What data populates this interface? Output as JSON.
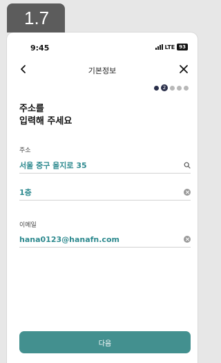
{
  "badge": {
    "label": "1.7"
  },
  "status_bar": {
    "time": "9:45",
    "network": "LTE",
    "battery": "93"
  },
  "header": {
    "title": "기본정보"
  },
  "progress": {
    "current_step": "2",
    "total_steps": 5,
    "current_index": 2
  },
  "heading": {
    "line1": "주소를",
    "line2": "입력해 주세요"
  },
  "address": {
    "label": "주소",
    "value": "서울 중구 을지로 35",
    "detail_value": "1층"
  },
  "email": {
    "label": "이메일",
    "value": "hana0123@hanafn.com"
  },
  "next_button": {
    "label": "다음"
  },
  "colors": {
    "accent": "#43908f",
    "value_text": "#2e8a8f",
    "step_dot": "#2a2f4a"
  }
}
